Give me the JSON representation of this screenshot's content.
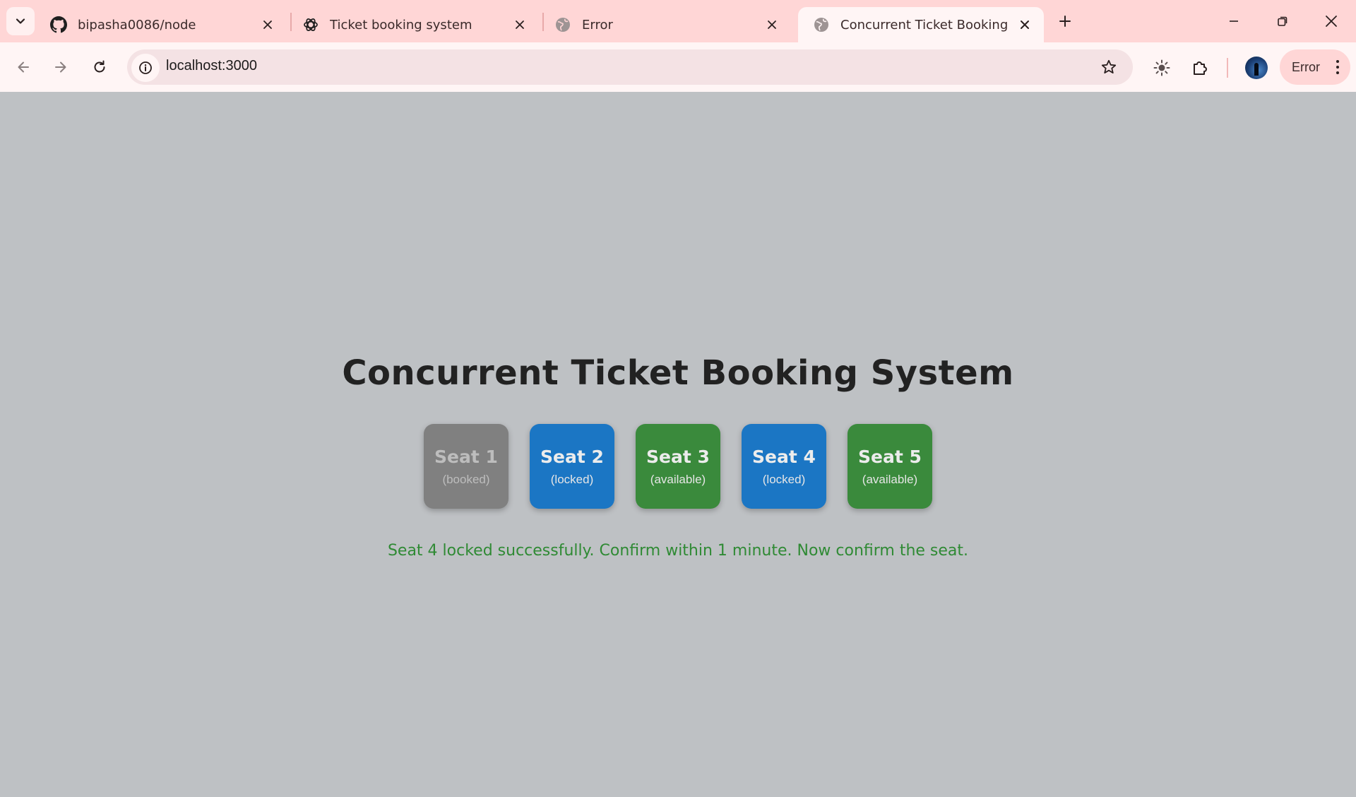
{
  "browser": {
    "tabs": [
      {
        "title": "bipasha0086/node",
        "icon": "github-icon",
        "active": false
      },
      {
        "title": "Ticket booking system",
        "icon": "openai-icon",
        "active": false
      },
      {
        "title": "Error",
        "icon": "globe-icon",
        "active": false
      },
      {
        "title": "Concurrent Ticket Booking",
        "icon": "globe-icon",
        "active": true
      }
    ],
    "address": "localhost:3000",
    "profile_chip": "Error",
    "colors": {
      "tabstrip": "#ffd6d6",
      "toolbar": "#fff5f5",
      "omnibox": "#f4e2e4"
    }
  },
  "page": {
    "title": "Concurrent Ticket Booking System",
    "seats": [
      {
        "name": "Seat 1",
        "status": "(booked)",
        "state": "booked",
        "color": "#808080"
      },
      {
        "name": "Seat 2",
        "status": "(locked)",
        "state": "locked",
        "color": "#1b76c4"
      },
      {
        "name": "Seat 3",
        "status": "(available)",
        "state": "available",
        "color": "#3a8a3c"
      },
      {
        "name": "Seat 4",
        "status": "(locked)",
        "state": "locked",
        "color": "#1b76c4"
      },
      {
        "name": "Seat 5",
        "status": "(available)",
        "state": "available",
        "color": "#3a8a3c"
      }
    ],
    "message": "Seat 4 locked successfully. Confirm within 1 minute. Now confirm the seat.",
    "message_color": "#2f8a34",
    "background": "#bec1c4"
  }
}
